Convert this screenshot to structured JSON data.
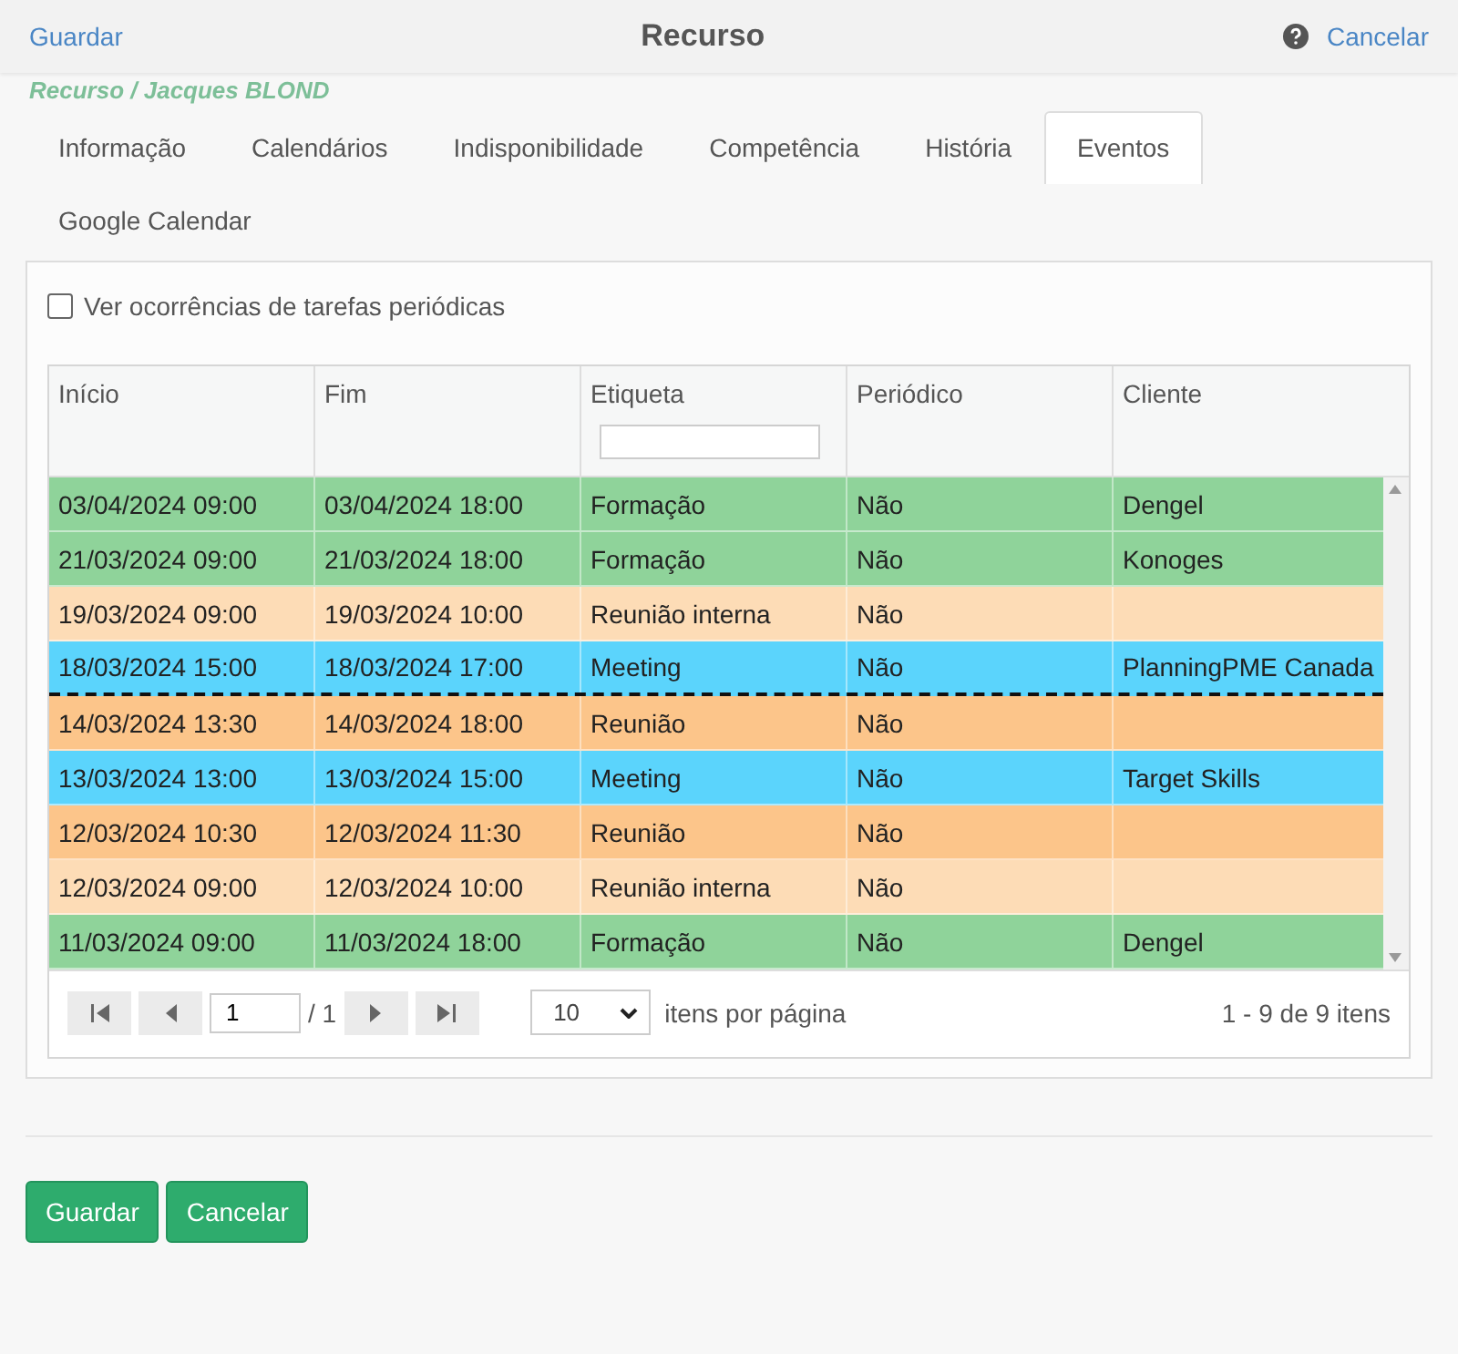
{
  "header": {
    "save_link": "Guardar",
    "title": "Recurso",
    "cancel_link": "Cancelar"
  },
  "breadcrumb": "Recurso / Jacques BLOND",
  "tabs": [
    {
      "label": "Informação",
      "selected": false
    },
    {
      "label": "Calendários",
      "selected": false
    },
    {
      "label": "Indisponibilidade",
      "selected": false
    },
    {
      "label": "Competência",
      "selected": false
    },
    {
      "label": "História",
      "selected": false
    },
    {
      "label": "Eventos",
      "selected": true
    },
    {
      "label": "Google Calendar",
      "selected": false
    }
  ],
  "recurring_option": {
    "label": "Ver ocorrências de tarefas periódicas",
    "checked": false
  },
  "table": {
    "columns": [
      {
        "label": "Início",
        "kind": "plain"
      },
      {
        "label": "Fim",
        "kind": "plain"
      },
      {
        "label": "Etiqueta",
        "kind": "filtered"
      },
      {
        "label": "Periódico",
        "kind": "plain"
      },
      {
        "label": "Cliente",
        "kind": "plain"
      }
    ],
    "rows": [
      {
        "color": "#8fd39a",
        "line_below": false,
        "cells": [
          "03/04/2024 09:00",
          "03/04/2024 18:00",
          "Formação",
          "Não",
          "Dengel"
        ]
      },
      {
        "color": "#8fd39a",
        "line_below": false,
        "cells": [
          "21/03/2024 09:00",
          "21/03/2024 18:00",
          "Formação",
          "Não",
          "Konoges"
        ]
      },
      {
        "color": "#fddcb6",
        "line_below": false,
        "cells": [
          "19/03/2024 09:00",
          "19/03/2024 10:00",
          "Reunião interna",
          "Não",
          ""
        ]
      },
      {
        "color": "#5bd4fc",
        "line_below": true,
        "cells": [
          "18/03/2024 15:00",
          "18/03/2024 17:00",
          "Meeting",
          "Não",
          "PlanningPME Canada"
        ]
      },
      {
        "color": "#fcc58a",
        "line_below": false,
        "cells": [
          "14/03/2024 13:30",
          "14/03/2024 18:00",
          "Reunião",
          "Não",
          ""
        ]
      },
      {
        "color": "#5bd4fc",
        "line_below": false,
        "cells": [
          "13/03/2024 13:00",
          "13/03/2024 15:00",
          "Meeting",
          "Não",
          "Target Skills"
        ]
      },
      {
        "color": "#fcc58a",
        "line_below": false,
        "cells": [
          "12/03/2024 10:30",
          "12/03/2024 11:30",
          "Reunião",
          "Não",
          ""
        ]
      },
      {
        "color": "#fddcb6",
        "line_below": false,
        "cells": [
          "12/03/2024 09:00",
          "12/03/2024 10:00",
          "Reunião interna",
          "Não",
          ""
        ]
      },
      {
        "color": "#8fd39a",
        "line_below": false,
        "cells": [
          "11/03/2024 09:00",
          "11/03/2024 18:00",
          "Formação",
          "Não",
          "Dengel"
        ]
      }
    ]
  },
  "pager": {
    "page": "1",
    "of_pages": "/ 1",
    "page_size": "10",
    "page_size_label": "itens por página",
    "summary": "1 - 9 de 9 itens"
  },
  "buttons": [
    {
      "label": "Guardar"
    },
    {
      "label": "Cancelar"
    }
  ]
}
